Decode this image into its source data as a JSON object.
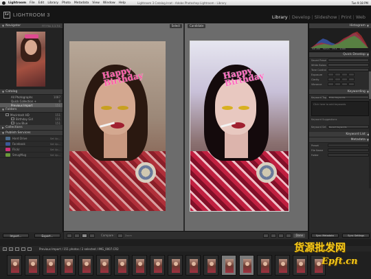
{
  "menubar": {
    "app_name": "Lightroom",
    "items": [
      "File",
      "Edit",
      "Library",
      "Photo",
      "Metadata",
      "View",
      "Window",
      "Help"
    ],
    "window_title": "Lightroom 3 Catalog.lrcat - Adobe Photoshop Lightroom - Library",
    "time": "Tue 9:18 PM"
  },
  "identity": {
    "logo_letters": "Lr",
    "product": "LIGHTROOM 3"
  },
  "modules": [
    "Library",
    "Develop",
    "Slideshow",
    "Print",
    "Web"
  ],
  "active_module": "Library",
  "left_panel": {
    "navigator_title": "Navigator",
    "navigator_opts": "FIT  FILL  1:1  3:1",
    "catalog_title": "Catalog",
    "catalog_items": [
      {
        "label": "All Photographs",
        "count": "1087"
      },
      {
        "label": "Quick Collection +",
        "count": "0"
      },
      {
        "label": "Previous Import",
        "count": "151"
      }
    ],
    "folders_title": "Folders",
    "folder_items": [
      {
        "label": "Macintosh HD",
        "count": "151"
      },
      {
        "label": "Birthday Girl",
        "count": "151"
      },
      {
        "label": "Lou Blue",
        "count": "151"
      }
    ],
    "collections_title": "Collections",
    "publish_title": "Publish Services",
    "publish_items": [
      {
        "label": "Hard Drive",
        "setup": "Set Up...",
        "color": "#4a6a8a"
      },
      {
        "label": "Facebook",
        "setup": "Set Up...",
        "color": "#3b5998"
      },
      {
        "label": "Flickr",
        "setup": "Set Up...",
        "color": "#d0307a"
      },
      {
        "label": "SmugMug",
        "setup": "Set Up...",
        "color": "#6a9a3a"
      }
    ],
    "import_label": "Import...",
    "export_label": "Export..."
  },
  "compare": {
    "select_tag": "Select",
    "candidate_tag": "Candidate",
    "tiara_text": "Happy Birthday"
  },
  "center_toolbar": {
    "compare_label": "Compare :",
    "zoom_label": "Zoom",
    "done_label": "Done"
  },
  "right_panel": {
    "histogram_title": "Histogram",
    "hist_info": [
      "ISO 200",
      "50mm",
      "f/5.6",
      "1/160"
    ],
    "quick_develop_title": "Quick Develop",
    "qd_rows": [
      "Saved Preset",
      "White Balance",
      "Tone Control",
      "Exposure",
      "Clarity",
      "Vibrance"
    ],
    "keywording_title": "Keywording",
    "keyword_tags_label": "Keyword Tags",
    "keyword_tags_value": "Enter Keywords",
    "keyword_placeholder": "Click here to add keywords",
    "suggestions_label": "Keyword Suggestions",
    "keyword_set_label": "Keyword Set",
    "keyword_set_value": "Recent Keywords",
    "keyword_list_title": "Keyword List",
    "metadata_title": "Metadata",
    "meta_rows": [
      "Preset",
      "File Name",
      "Folder"
    ],
    "sync_metadata": "Sync Metadata",
    "sync_settings": "Sync Settings"
  },
  "filmstrip": {
    "source_label": "Previous Import / 151 photos / 2 selected / IMG_0007.CR2",
    "page_numbers": [
      "1",
      "2"
    ],
    "thumb_count": 18,
    "selected_indices": [
      12,
      13
    ]
  },
  "watermark": {
    "chinese": "货源批发网",
    "url": "Epft.cn"
  }
}
